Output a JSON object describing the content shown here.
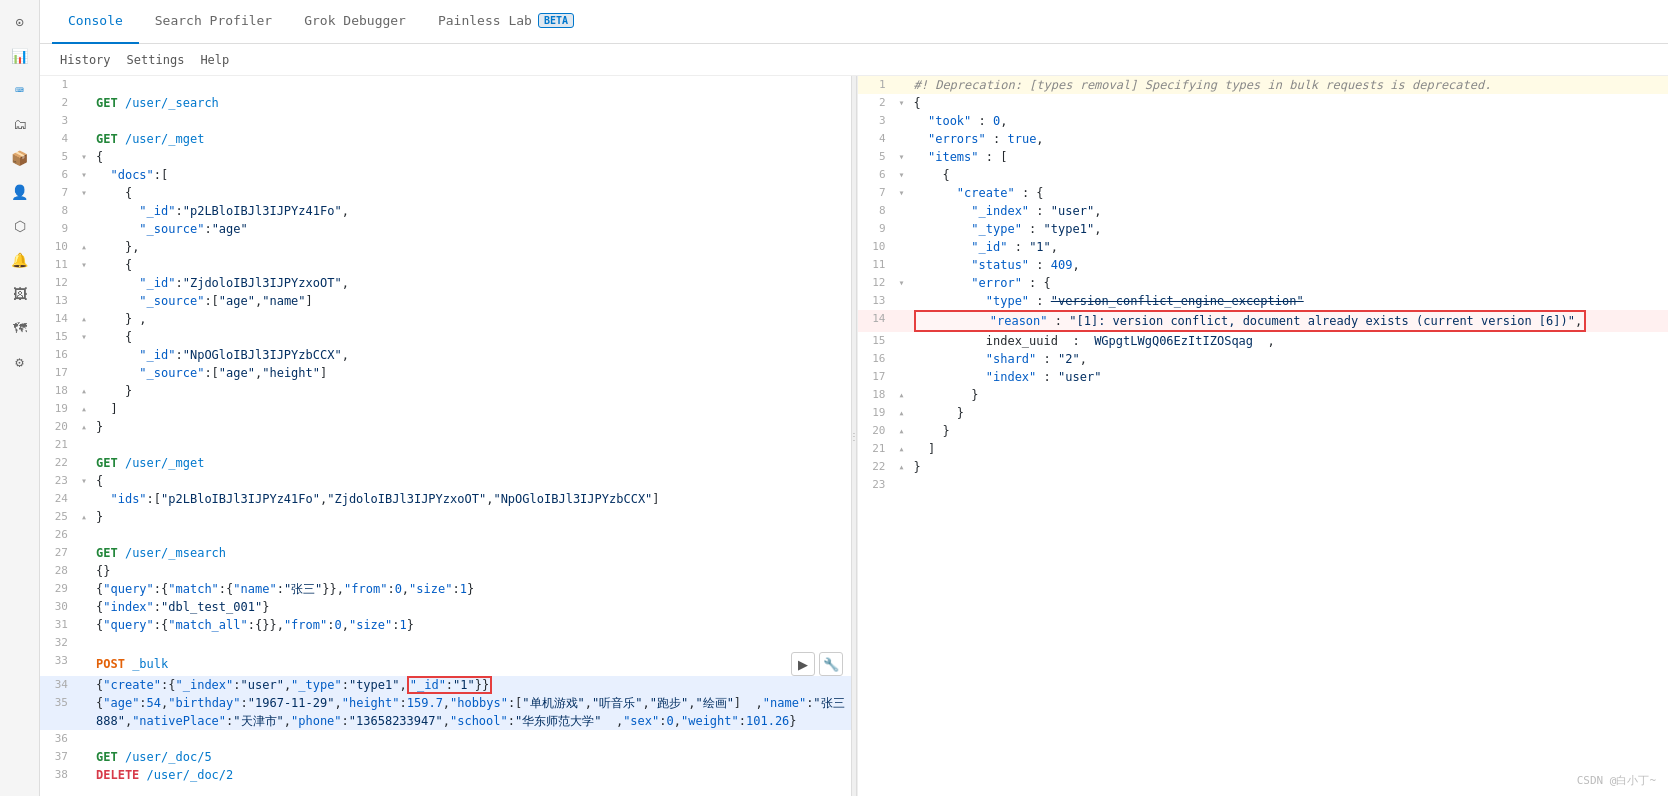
{
  "tabs": [
    {
      "label": "Console",
      "active": true
    },
    {
      "label": "Search Profiler",
      "active": false
    },
    {
      "label": "Grok Debugger",
      "active": false
    },
    {
      "label": "Painless Lab",
      "active": false,
      "beta": true
    }
  ],
  "subbar": [
    {
      "label": "History"
    },
    {
      "label": "Settings"
    },
    {
      "label": "Help"
    }
  ],
  "left_lines": [
    {
      "num": 1,
      "gutter": "",
      "content": "",
      "type": "blank"
    },
    {
      "num": 2,
      "gutter": "",
      "content": "GET /user/_search",
      "type": "request"
    },
    {
      "num": 3,
      "gutter": "",
      "content": "",
      "type": "blank"
    },
    {
      "num": 4,
      "gutter": "",
      "content": "GET /user/_mget",
      "type": "request"
    },
    {
      "num": 5,
      "gutter": "▾",
      "content": "{",
      "type": "bracket"
    },
    {
      "num": 6,
      "gutter": "▾",
      "content": "  \"docs\":[",
      "type": "code"
    },
    {
      "num": 7,
      "gutter": "▾",
      "content": "    {",
      "type": "bracket"
    },
    {
      "num": 8,
      "gutter": "",
      "content": "      \"_id\":\"p2LBloIBJl3IJPYz41Fo\",",
      "type": "code"
    },
    {
      "num": 9,
      "gutter": "",
      "content": "      \"_source\":\"age\"",
      "type": "code"
    },
    {
      "num": 10,
      "gutter": "▴",
      "content": "    },",
      "type": "bracket"
    },
    {
      "num": 11,
      "gutter": "▾",
      "content": "    {",
      "type": "bracket"
    },
    {
      "num": 12,
      "gutter": "",
      "content": "      \"_id\":\"ZjdoloIBJl3IJPYzxoOT\",",
      "type": "code"
    },
    {
      "num": 13,
      "gutter": "",
      "content": "      \"_source\":[\"age\",\"name\"]",
      "type": "code"
    },
    {
      "num": 14,
      "gutter": "▴",
      "content": "    } ,",
      "type": "bracket"
    },
    {
      "num": 15,
      "gutter": "▾",
      "content": "    {",
      "type": "bracket"
    },
    {
      "num": 16,
      "gutter": "",
      "content": "      \"_id\":\"NpOGloIBJl3IJPYzbCCX\",",
      "type": "code"
    },
    {
      "num": 17,
      "gutter": "",
      "content": "      \"_source\":[\"age\",\"height\"]",
      "type": "code"
    },
    {
      "num": 18,
      "gutter": "▴",
      "content": "    }",
      "type": "bracket"
    },
    {
      "num": 19,
      "gutter": "▴",
      "content": "  ]",
      "type": "bracket"
    },
    {
      "num": 20,
      "gutter": "▴",
      "content": "}",
      "type": "bracket"
    },
    {
      "num": 21,
      "gutter": "",
      "content": "",
      "type": "blank"
    },
    {
      "num": 22,
      "gutter": "",
      "content": "GET /user/_mget",
      "type": "request"
    },
    {
      "num": 23,
      "gutter": "▾",
      "content": "{",
      "type": "bracket"
    },
    {
      "num": 24,
      "gutter": "",
      "content": "  \"ids\":[\"p2LBloIBJl3IJPYz41Fo\",\"ZjdoloIBJl3IJPYzxoOT\",\"NpOGloIBJl3IJPYzbCCX\"]",
      "type": "code"
    },
    {
      "num": 25,
      "gutter": "▴",
      "content": "}",
      "type": "bracket"
    },
    {
      "num": 26,
      "gutter": "",
      "content": "",
      "type": "blank"
    },
    {
      "num": 27,
      "gutter": "",
      "content": "GET /user/_msearch",
      "type": "request"
    },
    {
      "num": 28,
      "gutter": "",
      "content": "{}",
      "type": "code"
    },
    {
      "num": 29,
      "gutter": "",
      "content": "{\"query\":{\"match\":{\"name\":\"张三\"}},\"from\":0,\"size\":1}",
      "type": "code"
    },
    {
      "num": 30,
      "gutter": "",
      "content": "{\"index\":\"dbl_test_001\"}",
      "type": "code"
    },
    {
      "num": 31,
      "gutter": "",
      "content": "{\"query\":{\"match_all\":{}},\"from\":0,\"size\":1}",
      "type": "code"
    },
    {
      "num": 32,
      "gutter": "",
      "content": "",
      "type": "blank"
    },
    {
      "num": 33,
      "gutter": "",
      "content": "POST _bulk",
      "type": "request_post"
    },
    {
      "num": 34,
      "gutter": "",
      "content": "{\"create\":{\"_index\":\"user\",\"_type\":\"type1\",\"_id\":\"1\"}}",
      "type": "code_selected",
      "highlight_part": "{\"_id\":\"1\"}}"
    },
    {
      "num": 35,
      "gutter": "",
      "content": "{\"age\":54,\"birthday\":\"1967-11-29\",\"height\":159.7,\"hobbys\":[\"单机游戏\",\"听音乐\",\"跑步\",\"绘画\"]  ,\"name\":\"张三888\",\"nativePlace\":\"天津市\",\"phone\":\"13658233947\",\"school\":\"华东师范大学\"  ,\"sex\":0,\"weight\":101.26}",
      "type": "code_selected"
    },
    {
      "num": 36,
      "gutter": "",
      "content": "",
      "type": "blank"
    },
    {
      "num": 37,
      "gutter": "",
      "content": "GET /user/_doc/5",
      "type": "request"
    },
    {
      "num": 38,
      "gutter": "",
      "content": "DELETE /user/_doc/2",
      "type": "request_delete"
    }
  ],
  "right_lines": [
    {
      "num": 1,
      "content": "#! Deprecation: [types removal] Specifying types in bulk requests is deprecated.",
      "type": "warning"
    },
    {
      "num": 2,
      "gutter": "▾",
      "content": "{",
      "type": "bracket"
    },
    {
      "num": 3,
      "gutter": "",
      "content": "  \"took\" : 0,",
      "type": "code"
    },
    {
      "num": 4,
      "gutter": "",
      "content": "  \"errors\" : true,",
      "type": "code"
    },
    {
      "num": 5,
      "gutter": "▾",
      "content": "  \"items\" : [",
      "type": "code"
    },
    {
      "num": 6,
      "gutter": "▾",
      "content": "    {",
      "type": "bracket"
    },
    {
      "num": 7,
      "gutter": "▾",
      "content": "      \"create\" : {",
      "type": "bracket"
    },
    {
      "num": 8,
      "gutter": "",
      "content": "        \"_index\" : \"user\",",
      "type": "code"
    },
    {
      "num": 9,
      "gutter": "",
      "content": "        \"_type\" : \"type1\",",
      "type": "code"
    },
    {
      "num": 10,
      "gutter": "",
      "content": "        \"_id\" : \"1\",",
      "type": "code"
    },
    {
      "num": 11,
      "gutter": "",
      "content": "        \"status\" : 409,",
      "type": "code"
    },
    {
      "num": 12,
      "gutter": "▾",
      "content": "        \"error\" : {",
      "type": "bracket"
    },
    {
      "num": 13,
      "gutter": "",
      "content": "          \"type\" : \"version_conflict_engine_exception\"",
      "type": "code"
    },
    {
      "num": 14,
      "gutter": "",
      "content": "          \"reason\" : \"[1]: version conflict, document already exists (current version [6])\",",
      "type": "code_highlight"
    },
    {
      "num": 15,
      "gutter": "",
      "content": "          index_uuid  :  WGpgtLWgQ06EzItIZOSqag  ,",
      "type": "code"
    },
    {
      "num": 16,
      "gutter": "",
      "content": "          \"shard\" : \"2\",",
      "type": "code"
    },
    {
      "num": 17,
      "gutter": "",
      "content": "          \"index\" : \"user\"",
      "type": "code"
    },
    {
      "num": 18,
      "gutter": "▴",
      "content": "        }",
      "type": "bracket"
    },
    {
      "num": 19,
      "gutter": "▴",
      "content": "      }",
      "type": "bracket"
    },
    {
      "num": 20,
      "gutter": "▴",
      "content": "    }",
      "type": "bracket"
    },
    {
      "num": 21,
      "gutter": "▴",
      "content": "  ]",
      "type": "bracket"
    },
    {
      "num": 22,
      "gutter": "▴",
      "content": "}",
      "type": "bracket"
    },
    {
      "num": 23,
      "gutter": "",
      "content": "",
      "type": "blank"
    }
  ],
  "watermark": "CSDN @白小丁~"
}
